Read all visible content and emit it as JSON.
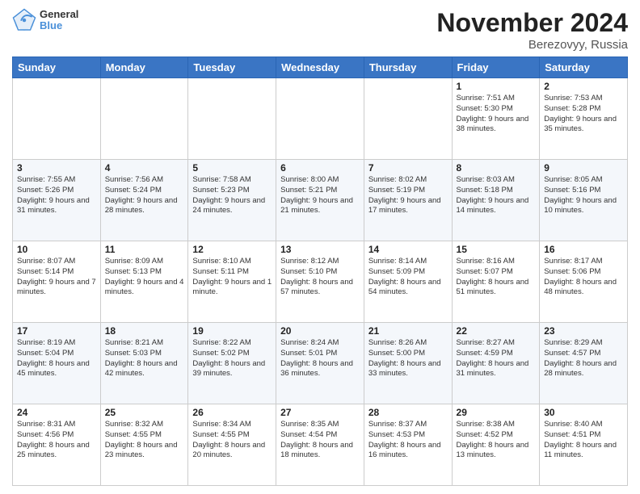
{
  "header": {
    "logo": {
      "general": "General",
      "blue": "Blue"
    },
    "title": "November 2024",
    "location": "Berezovyy, Russia"
  },
  "weekdays": [
    "Sunday",
    "Monday",
    "Tuesday",
    "Wednesday",
    "Thursday",
    "Friday",
    "Saturday"
  ],
  "weeks": [
    [
      {
        "day": null
      },
      {
        "day": null
      },
      {
        "day": null
      },
      {
        "day": null
      },
      {
        "day": null
      },
      {
        "day": "1",
        "sunrise": "7:51 AM",
        "sunset": "5:30 PM",
        "daylight": "9 hours and 38 minutes."
      },
      {
        "day": "2",
        "sunrise": "7:53 AM",
        "sunset": "5:28 PM",
        "daylight": "9 hours and 35 minutes."
      }
    ],
    [
      {
        "day": "3",
        "sunrise": "7:55 AM",
        "sunset": "5:26 PM",
        "daylight": "9 hours and 31 minutes."
      },
      {
        "day": "4",
        "sunrise": "7:56 AM",
        "sunset": "5:24 PM",
        "daylight": "9 hours and 28 minutes."
      },
      {
        "day": "5",
        "sunrise": "7:58 AM",
        "sunset": "5:23 PM",
        "daylight": "9 hours and 24 minutes."
      },
      {
        "day": "6",
        "sunrise": "8:00 AM",
        "sunset": "5:21 PM",
        "daylight": "9 hours and 21 minutes."
      },
      {
        "day": "7",
        "sunrise": "8:02 AM",
        "sunset": "5:19 PM",
        "daylight": "9 hours and 17 minutes."
      },
      {
        "day": "8",
        "sunrise": "8:03 AM",
        "sunset": "5:18 PM",
        "daylight": "9 hours and 14 minutes."
      },
      {
        "day": "9",
        "sunrise": "8:05 AM",
        "sunset": "5:16 PM",
        "daylight": "9 hours and 10 minutes."
      }
    ],
    [
      {
        "day": "10",
        "sunrise": "8:07 AM",
        "sunset": "5:14 PM",
        "daylight": "9 hours and 7 minutes."
      },
      {
        "day": "11",
        "sunrise": "8:09 AM",
        "sunset": "5:13 PM",
        "daylight": "9 hours and 4 minutes."
      },
      {
        "day": "12",
        "sunrise": "8:10 AM",
        "sunset": "5:11 PM",
        "daylight": "9 hours and 1 minute."
      },
      {
        "day": "13",
        "sunrise": "8:12 AM",
        "sunset": "5:10 PM",
        "daylight": "8 hours and 57 minutes."
      },
      {
        "day": "14",
        "sunrise": "8:14 AM",
        "sunset": "5:09 PM",
        "daylight": "8 hours and 54 minutes."
      },
      {
        "day": "15",
        "sunrise": "8:16 AM",
        "sunset": "5:07 PM",
        "daylight": "8 hours and 51 minutes."
      },
      {
        "day": "16",
        "sunrise": "8:17 AM",
        "sunset": "5:06 PM",
        "daylight": "8 hours and 48 minutes."
      }
    ],
    [
      {
        "day": "17",
        "sunrise": "8:19 AM",
        "sunset": "5:04 PM",
        "daylight": "8 hours and 45 minutes."
      },
      {
        "day": "18",
        "sunrise": "8:21 AM",
        "sunset": "5:03 PM",
        "daylight": "8 hours and 42 minutes."
      },
      {
        "day": "19",
        "sunrise": "8:22 AM",
        "sunset": "5:02 PM",
        "daylight": "8 hours and 39 minutes."
      },
      {
        "day": "20",
        "sunrise": "8:24 AM",
        "sunset": "5:01 PM",
        "daylight": "8 hours and 36 minutes."
      },
      {
        "day": "21",
        "sunrise": "8:26 AM",
        "sunset": "5:00 PM",
        "daylight": "8 hours and 33 minutes."
      },
      {
        "day": "22",
        "sunrise": "8:27 AM",
        "sunset": "4:59 PM",
        "daylight": "8 hours and 31 minutes."
      },
      {
        "day": "23",
        "sunrise": "8:29 AM",
        "sunset": "4:57 PM",
        "daylight": "8 hours and 28 minutes."
      }
    ],
    [
      {
        "day": "24",
        "sunrise": "8:31 AM",
        "sunset": "4:56 PM",
        "daylight": "8 hours and 25 minutes."
      },
      {
        "day": "25",
        "sunrise": "8:32 AM",
        "sunset": "4:55 PM",
        "daylight": "8 hours and 23 minutes."
      },
      {
        "day": "26",
        "sunrise": "8:34 AM",
        "sunset": "4:55 PM",
        "daylight": "8 hours and 20 minutes."
      },
      {
        "day": "27",
        "sunrise": "8:35 AM",
        "sunset": "4:54 PM",
        "daylight": "8 hours and 18 minutes."
      },
      {
        "day": "28",
        "sunrise": "8:37 AM",
        "sunset": "4:53 PM",
        "daylight": "8 hours and 16 minutes."
      },
      {
        "day": "29",
        "sunrise": "8:38 AM",
        "sunset": "4:52 PM",
        "daylight": "8 hours and 13 minutes."
      },
      {
        "day": "30",
        "sunrise": "8:40 AM",
        "sunset": "4:51 PM",
        "daylight": "8 hours and 11 minutes."
      }
    ]
  ]
}
